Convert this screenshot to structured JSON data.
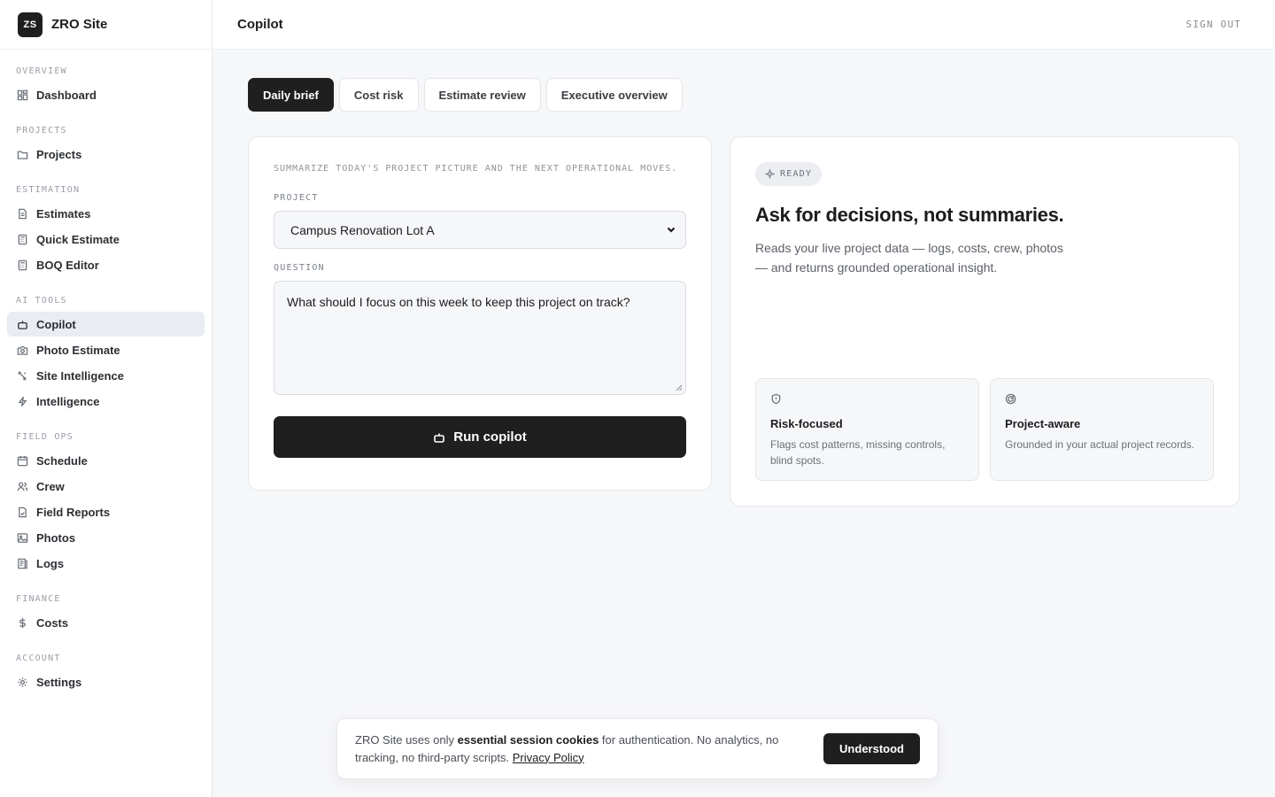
{
  "app": {
    "logo": "ZS",
    "name": "ZRO Site"
  },
  "header": {
    "title": "Copilot",
    "sign_out": "SIGN OUT"
  },
  "sidebar": {
    "sections": [
      {
        "label": "OVERVIEW",
        "items": [
          {
            "label": "Dashboard",
            "icon": "dashboard-icon"
          }
        ]
      },
      {
        "label": "PROJECTS",
        "items": [
          {
            "label": "Projects",
            "icon": "folder-icon"
          }
        ]
      },
      {
        "label": "ESTIMATION",
        "items": [
          {
            "label": "Estimates",
            "icon": "document-icon"
          },
          {
            "label": "Quick Estimate",
            "icon": "calculator-icon"
          },
          {
            "label": "BOQ Editor",
            "icon": "calculator-icon"
          }
        ]
      },
      {
        "label": "AI TOOLS",
        "items": [
          {
            "label": "Copilot",
            "icon": "bot-icon",
            "active": true
          },
          {
            "label": "Photo Estimate",
            "icon": "camera-icon"
          },
          {
            "label": "Site Intelligence",
            "icon": "satellite-icon"
          },
          {
            "label": "Intelligence",
            "icon": "lightning-icon"
          }
        ]
      },
      {
        "label": "FIELD OPS",
        "items": [
          {
            "label": "Schedule",
            "icon": "calendar-icon"
          },
          {
            "label": "Crew",
            "icon": "users-icon"
          },
          {
            "label": "Field Reports",
            "icon": "report-icon"
          },
          {
            "label": "Photos",
            "icon": "image-icon"
          },
          {
            "label": "Logs",
            "icon": "logs-icon"
          }
        ]
      },
      {
        "label": "FINANCE",
        "items": [
          {
            "label": "Costs",
            "icon": "dollar-icon"
          }
        ]
      },
      {
        "label": "ACCOUNT",
        "items": [
          {
            "label": "Settings",
            "icon": "gear-icon"
          }
        ]
      }
    ]
  },
  "tabs": [
    {
      "label": "Daily brief",
      "active": true
    },
    {
      "label": "Cost risk"
    },
    {
      "label": "Estimate review"
    },
    {
      "label": "Executive overview"
    }
  ],
  "form": {
    "intro": "SUMMARIZE TODAY'S PROJECT PICTURE AND THE NEXT OPERATIONAL MOVES.",
    "project_label": "PROJECT",
    "project_value": "Campus Renovation Lot A",
    "question_label": "QUESTION",
    "question_value": "What should I focus on this week to keep this project on track?",
    "run_label": "Run copilot"
  },
  "panel": {
    "badge": "READY",
    "title": "Ask for decisions, not summaries.",
    "description": "Reads your live project data — logs, costs, crew, photos — and returns grounded operational insight.",
    "features": [
      {
        "icon": "shield-icon",
        "title": "Risk-focused",
        "description": "Flags cost patterns, missing controls, blind spots."
      },
      {
        "icon": "target-icon",
        "title": "Project-aware",
        "description": "Grounded in your actual project records."
      }
    ]
  },
  "cookie": {
    "text_before": "ZRO Site uses only ",
    "text_bold": "essential session cookies",
    "text_after": " for authentication. No analytics, no tracking, no third-party scripts. ",
    "link": "Privacy Policy",
    "button": "Understood"
  }
}
